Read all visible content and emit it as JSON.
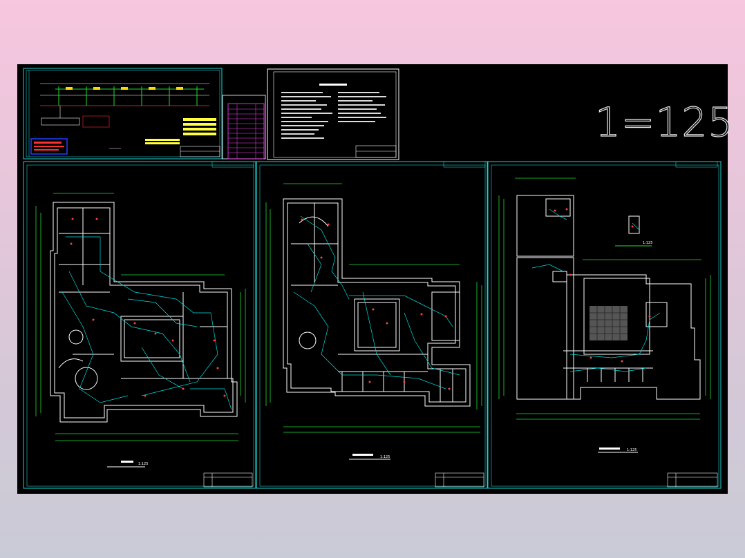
{
  "drawing": {
    "scale_label": "1=125",
    "sheet1_caption": "1:125",
    "sheet2_caption": "1:125",
    "sheet3_caption": "1:125",
    "sheet3_inset_caption": "1:125"
  },
  "colors": {
    "background": "#000000",
    "frame": "#1fd0d0",
    "wiring": "#00e0e0",
    "dimension": "#22dd33",
    "walls": "#ffffff",
    "devices": "#ff4040",
    "table": "#ff40ff",
    "legend_box": "#2040ff"
  }
}
